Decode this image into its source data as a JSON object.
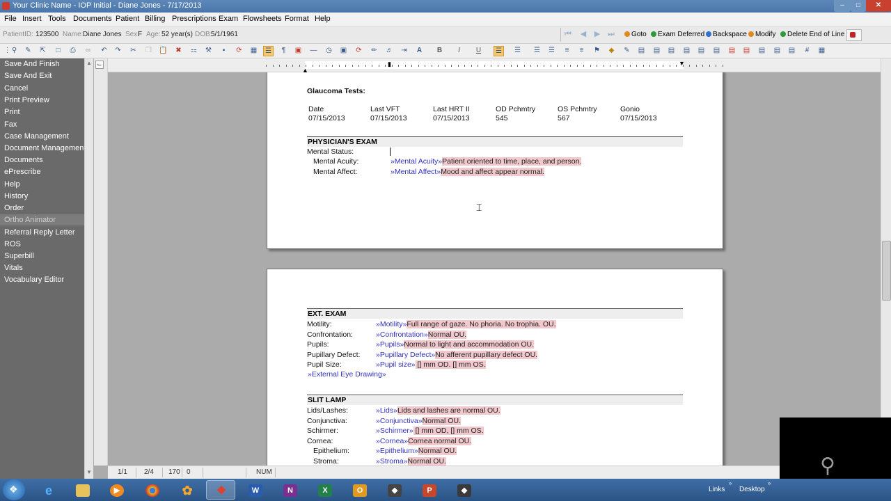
{
  "window": {
    "title": "Your Clinic Name - IOP Initial - Diane Jones - 7/17/2013"
  },
  "menu": [
    "File",
    "Insert",
    "Tools",
    "Documents",
    "Patient",
    "Billing",
    "Prescriptions",
    "Exam",
    "Flowsheets",
    "Format",
    "Help"
  ],
  "patient": {
    "id_label": "PatientID:",
    "id": "123500",
    "name_label": "Name:",
    "name": "Diane Jones",
    "sex_label": "Sex:",
    "sex": "F",
    "age_label": "Age:",
    "age": "52 year(s)",
    "dob_label": "DOB:",
    "dob": "5/1/1961"
  },
  "exam_toolbar": [
    "Goto",
    "Exam Deferred",
    "Backspace",
    "Modify",
    "Delete End of Line"
  ],
  "exam_toolbar_colors": [
    "#e08a1e",
    "#2c9a3b",
    "#2f6fd0",
    "#e08a1e",
    "#2c9a3b"
  ],
  "sidebar": [
    "Save And Finish",
    "Save And Exit",
    "Cancel",
    "Print Preview",
    "Print",
    "Fax",
    "Case Management",
    "Document Management",
    "Documents",
    "ePrescribe",
    "Help",
    "History",
    "Order",
    "Ortho Animator",
    "Referral Reply Letter",
    "ROS",
    "Superbill",
    "Vitals",
    "Vocabulary Editor"
  ],
  "doc": {
    "glaucoma_title": "Glaucoma Tests:",
    "glaucoma_headers": [
      "Date",
      "Last VFT",
      "Last HRT II",
      "OD Pchmtry",
      "OS Pchmtry",
      "Gonio"
    ],
    "glaucoma_values": [
      "07/15/2013",
      "07/15/2013",
      "07/15/2013",
      "545",
      "567",
      "07/15/2013"
    ],
    "physician_exam": {
      "heading": "PHYSICIAN'S EXAM",
      "mental_status": "Mental Status:",
      "rows": [
        {
          "label": "Mental Acuity:",
          "field": "»Mental Acuity»",
          "value": "Patient oriented to time, place, and person."
        },
        {
          "label": "Mental Affect:",
          "field": "»Mental Affect»",
          "value": "Mood and affect appear normal."
        }
      ]
    },
    "ext_exam": {
      "heading": "EXT. EXAM",
      "rows": [
        {
          "label": "Motility:",
          "field": "»Motility»",
          "value": "Full range of gaze. No phoria. No trophia. OU."
        },
        {
          "label": "Confrontation:",
          "field": "»Confrontation»",
          "value": "Normal OU."
        },
        {
          "label": "Pupils:",
          "field": "»Pupils»",
          "value": "Normal to light and accommodation OU."
        },
        {
          "label": "Pupillary Defect:",
          "field": "»Pupillary Defect»",
          "value": "No afferent pupillary defect OU."
        },
        {
          "label": "Pupil Size:",
          "field": "»Pupil size»",
          "value": " [] mm OD.  [] mm OS."
        }
      ],
      "drawing_link": "»External Eye Drawing»"
    },
    "slit_lamp": {
      "heading": "SLIT LAMP",
      "rows": [
        {
          "label": "Lids/Lashes:",
          "field": "»Lids»",
          "value": "Lids and lashes are normal OU."
        },
        {
          "label": "Conjunctiva:",
          "field": "»Conjunctiva»",
          "value": "Normal OU."
        },
        {
          "label": "Schirmer:",
          "field": "»Schirmer»",
          "value": " [] mm OD, [] mm OS."
        },
        {
          "label": "Cornea:",
          "field": "»Cornea»",
          "value": "Cornea normal OU."
        },
        {
          "label": "Epithelium:",
          "field": "»Epithelium»",
          "value": "Normal OU."
        },
        {
          "label": "Stroma:",
          "field": "»Stroma»",
          "value": "Normal OU."
        }
      ]
    }
  },
  "status": {
    "section": "1/1",
    "page": "2/4",
    "line": "170",
    "col": "0",
    "num": "NUM"
  },
  "taskbar": {
    "links": "Links",
    "desktop": "Desktop",
    "apps": [
      "W",
      "N",
      "X",
      "O",
      "P"
    ]
  }
}
